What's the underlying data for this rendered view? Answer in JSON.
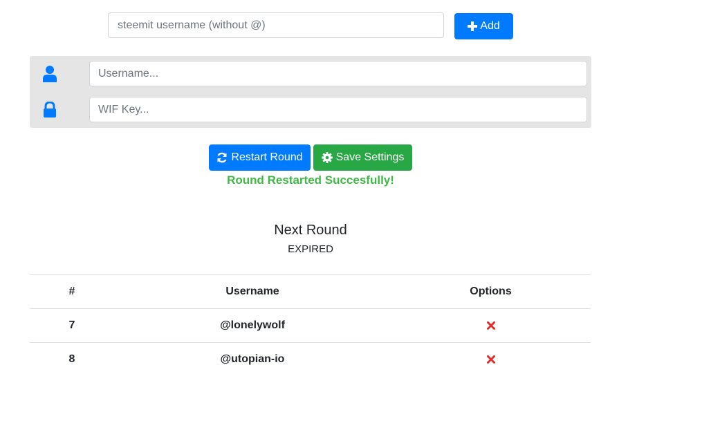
{
  "add_user": {
    "placeholder": "steemit username (without @)",
    "button_label": "Add"
  },
  "credentials": {
    "username_placeholder": "Username...",
    "wif_placeholder": "WIF Key..."
  },
  "actions": {
    "restart_label": "Restart Round",
    "save_label": "Save Settings",
    "status_message": "Round Restarted Succesfully!"
  },
  "next_round": {
    "title": "Next Round",
    "status": "EXPIRED"
  },
  "table": {
    "headers": {
      "num": "#",
      "username": "Username",
      "options": "Options"
    },
    "rows": [
      {
        "num": "7",
        "username": "@lonelywolf"
      },
      {
        "num": "8",
        "username": "@utopian-io"
      }
    ]
  },
  "colors": {
    "primary": "#007bff",
    "success": "#28a745",
    "danger": "#e02f2f",
    "panel": "#e5e5e5"
  }
}
